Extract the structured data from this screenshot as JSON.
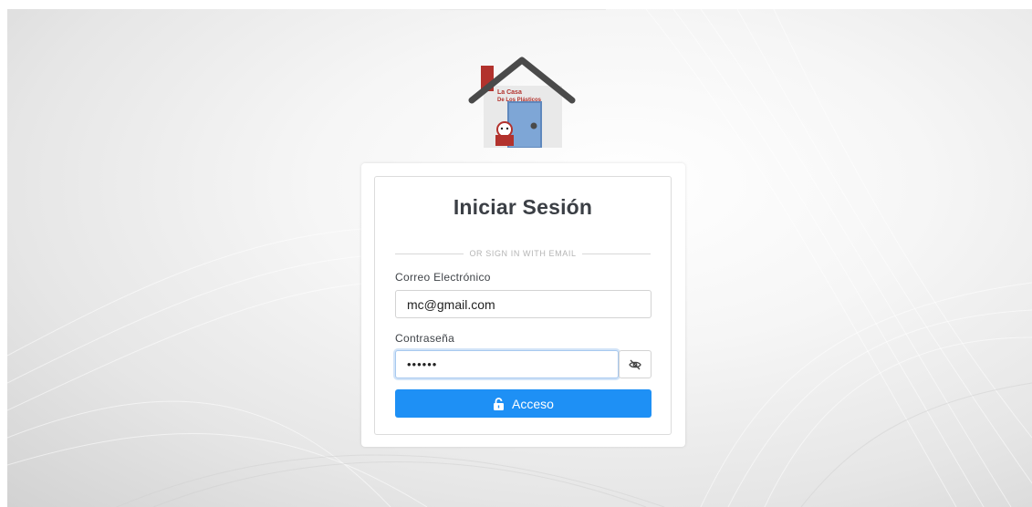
{
  "brand": {
    "logo_line1": "La Casa",
    "logo_line2": "De Los Plásticos"
  },
  "login": {
    "title": "Iniciar Sesión",
    "divider_text": "OR SIGN IN WITH EMAIL",
    "email_label": "Correo Electrónico",
    "email_value": "mc@gmail.com",
    "password_label": "Contraseña",
    "password_value": "••••••",
    "toggle_icon": "eye-off-icon",
    "submit_icon": "unlock-icon",
    "submit_label": "Acceso"
  },
  "colors": {
    "primary": "#1e90f5",
    "focus_border": "#a8c9ef",
    "title_text": "#3b3f45"
  }
}
